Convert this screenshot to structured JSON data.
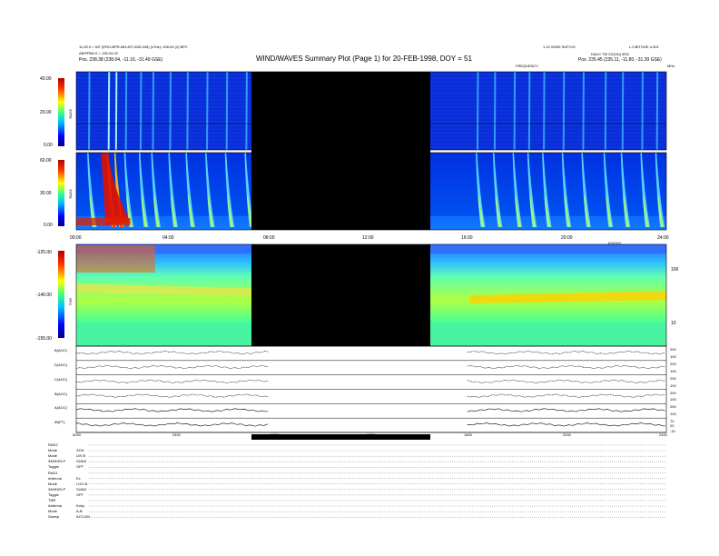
{
  "header": {
    "left_line1": "11.05.0 = NIT (ERO-BPR-MN-MT-JMD-DM) (V/Hz): 208.00 (2) BPC",
    "left_line2": "AB/PRIM-S = 135.04.02",
    "left_line3": "Pos. 238.38 (238.04, -11.16, -31.49 GSE)",
    "title": "WIND/WAVES Summary Plot (Page 1) for 20-FEB-1998, DOY = 51",
    "right_line1a": "1.10 WIND SUFCIO",
    "right_line1b": "L.0.BITOOE.n.501",
    "right_line2": "DAILY TM 23/(1\\b) 30\\0",
    "right_line3": "Pos. 235.45 (235.11, -11.80, -31.39 GSE)",
    "freq_label": "FREQUENCY",
    "mhz_label": "MHz",
    "khz_label": "KHZ/DC"
  },
  "panels": {
    "rad2": {
      "name": "RAD2",
      "ticks": [
        "40.00",
        "20.00",
        "0.00"
      ]
    },
    "rad1": {
      "name": "RAD1",
      "ticks": [
        "60.00",
        "30.00",
        "0.00"
      ]
    },
    "tnr": {
      "name": "TNR",
      "ticks": [
        "-125.00",
        "-140.00",
        "-155.00"
      ],
      "right_ticks": [
        "100",
        "10"
      ]
    }
  },
  "time_axis": [
    "00:00",
    "04:00",
    "08:00",
    "12:00",
    "16:00",
    "20:00",
    "24:00"
  ],
  "bottom_axis": [
    "0000",
    "0400",
    "0800",
    "1200",
    "1600",
    "2000",
    "2400"
  ],
  "param_rows": [
    {
      "label": "B(AGC)",
      "right": [
        "200",
        "100"
      ]
    },
    {
      "label": "D(AGC)",
      "right": [
        "200",
        "100"
      ]
    },
    {
      "label": "C(AGC)",
      "right": [
        "200",
        "100"
      ]
    },
    {
      "label": "B(AGC)",
      "right": [
        "200",
        "100"
      ]
    },
    {
      "label": "A(AGC)",
      "right": [
        "200",
        "100"
      ]
    },
    {
      "label": "IB(PT)",
      "right": [
        "70",
        "20",
        "-10"
      ]
    }
  ],
  "footer": [
    {
      "label": "RAD2",
      "value": ""
    },
    {
      "label": "Mode",
      "value": "SCN"
    },
    {
      "label": "Mode",
      "value": "LIN B"
    },
    {
      "label": "34MHZ/LP",
      "value": "SUM4"
    },
    {
      "label": "Toggle",
      "value": "OFF"
    },
    {
      "label": "RAD1",
      "value": ""
    },
    {
      "label": "Antenna",
      "value": "Ex"
    },
    {
      "label": "Mode",
      "value": "LOG B"
    },
    {
      "label": "34MHZ/LP",
      "value": "SUM4"
    },
    {
      "label": "Toggle",
      "value": "OFF"
    },
    {
      "label": "TNR",
      "value": ""
    },
    {
      "label": "Antenna",
      "value": "Exby"
    },
    {
      "label": "Mode",
      "value": "A-B"
    },
    {
      "label": "Sweep",
      "value": "ACCUM"
    }
  ],
  "colors": {
    "bg_low": "#0a2dd8",
    "gap": "#000000"
  },
  "chart_data": {
    "type": "heatmap",
    "title": "WIND/WAVES Summary Plot (Page 1) for 20-FEB-1998, DOY = 51",
    "x_range": [
      "00:00",
      "24:00"
    ],
    "data_gap": {
      "start": "07:50",
      "end": "15:55"
    },
    "panels": [
      {
        "name": "RAD2",
        "ylim": [
          0,
          40
        ]
      },
      {
        "name": "RAD1",
        "ylim": [
          0,
          60
        ]
      },
      {
        "name": "TNR",
        "ylim": [
          -155,
          -125
        ],
        "right_axis": "kHz",
        "right_ticks": [
          100,
          10
        ]
      }
    ],
    "bursts_hours": [
      0.5,
      1.3,
      1.6,
      2.0,
      2.6,
      3.1,
      3.8,
      4.5,
      5.3,
      6.1,
      6.9,
      7.5,
      16.3,
      17.0,
      17.8,
      18.4,
      19.0,
      19.8,
      20.6,
      21.5,
      22.2,
      23.0,
      23.6
    ]
  }
}
